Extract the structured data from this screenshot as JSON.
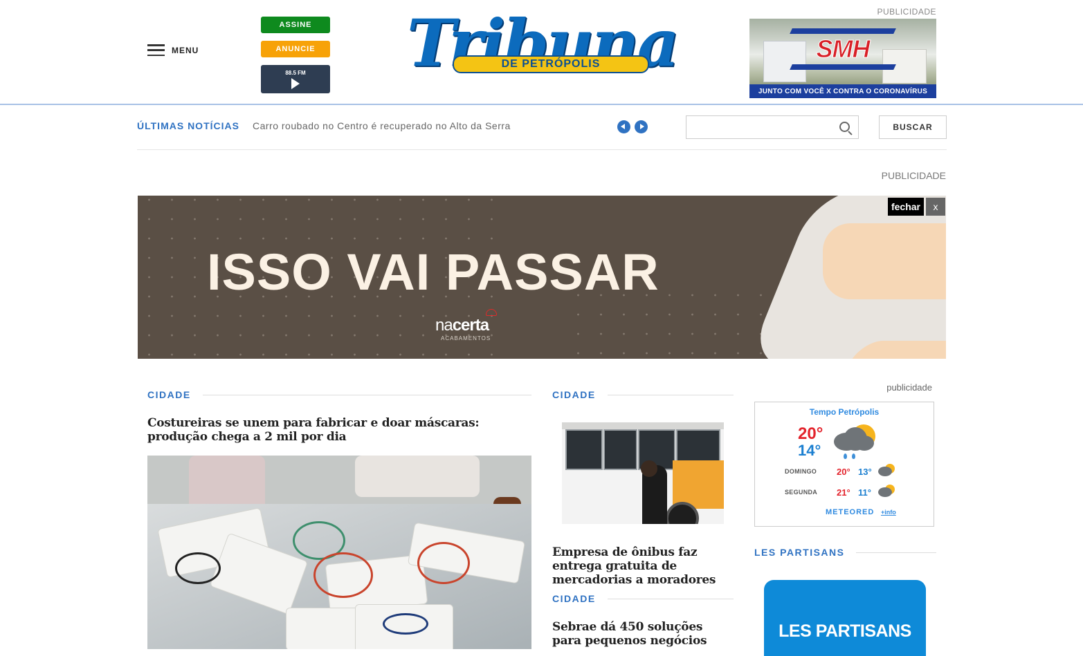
{
  "header": {
    "menu_label": "MENU",
    "assine_label": "ASSINE",
    "anuncie_label": "ANUNCIE",
    "radio_freq": "88.5 FM",
    "logo_word": "Tribuna",
    "logo_band": "DE PETRÓPOLIS",
    "publicidade": "PUBLICIDADE",
    "ad_brand": "SMH",
    "ad_caption": "JUNTO COM VOCÊ X CONTRA O CORONAVÍRUS"
  },
  "ticker": {
    "label": "ÚLTIMAS NOTÍCIAS",
    "headline": "Carro roubado no Centro é recuperado no Alto da Serra",
    "search_value": "",
    "search_button": "BUSCAR"
  },
  "banner": {
    "publicidade": "PUBLICIDADE",
    "headline": "ISSO VAI PASSAR",
    "brand_light": "na",
    "brand_bold": "certa",
    "brand_sub": "ACABAMENTOS",
    "close_label": "fechar",
    "close_x": "x"
  },
  "col1": {
    "section": "CIDADE",
    "headline": "Costureiras se unem para fabricar e doar máscaras: produção chega a 2 mil por dia"
  },
  "col2": {
    "section": "CIDADE",
    "headline": "Empresa de ônibus faz entrega gratuita de mercadorias a moradores",
    "section2": "CIDADE",
    "headline2": "Sebrae dá 450 soluções para pequenos negócios"
  },
  "sidebar": {
    "publicidade": "publicidade",
    "weather": {
      "title": "Tempo Petrópolis",
      "max": "20°",
      "min": "14°",
      "days": [
        {
          "name": "DOMINGO",
          "max": "20°",
          "min": "13°"
        },
        {
          "name": "SEGUNDA",
          "max": "21°",
          "min": "11°"
        }
      ],
      "brand": "METEORED",
      "info_link": "+info"
    },
    "section": "LES PARTISANS",
    "card_text": "LES PARTISANS"
  },
  "colors": {
    "accent": "#2f72c2",
    "assine": "#0e8a1e",
    "anuncie": "#f7a208",
    "radio": "#2e3d52",
    "logo_blue": "#0c6bbd",
    "logo_yellow": "#f4c414"
  }
}
